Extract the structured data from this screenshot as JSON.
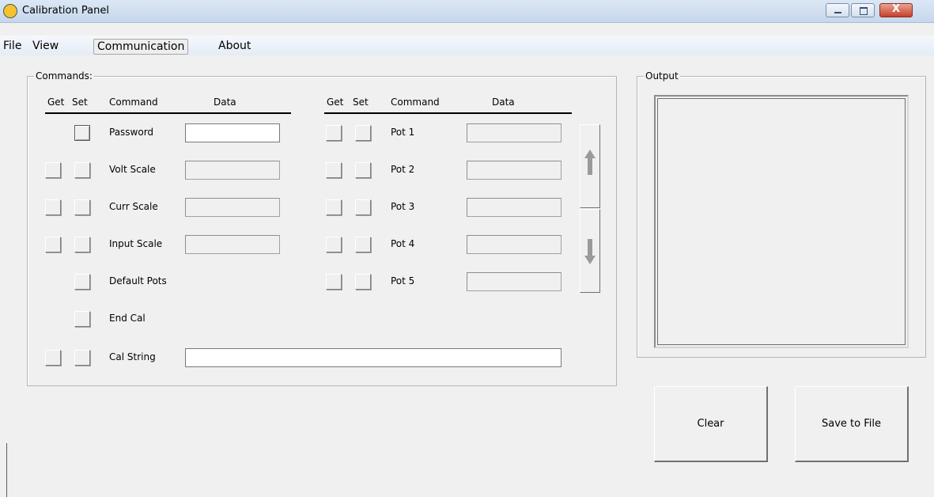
{
  "window": {
    "title": "Calibration Panel",
    "icon": "calibration-app-icon",
    "controls": {
      "minimize": "minimize-icon",
      "maximize": "maximize-icon",
      "close_glyph": "X"
    }
  },
  "menu": {
    "items": [
      "File",
      "View",
      "Communication",
      "About"
    ],
    "active": "Communication"
  },
  "commands": {
    "legend": "Commands:",
    "left_headers": {
      "get": "Get",
      "set": "Set",
      "command": "Command",
      "data": "Data"
    },
    "right_headers": {
      "get": "Get",
      "set": "Set",
      "command": "Command",
      "data": "Data"
    },
    "left_rows": [
      {
        "label": "Password",
        "has_get": false,
        "has_data": true,
        "data_value": ""
      },
      {
        "label": "Volt Scale",
        "has_get": true,
        "has_data": true,
        "data_value": ""
      },
      {
        "label": "Curr Scale",
        "has_get": true,
        "has_data": true,
        "data_value": ""
      },
      {
        "label": "Input Scale",
        "has_get": true,
        "has_data": true,
        "data_value": ""
      },
      {
        "label": "Default Pots",
        "has_get": false,
        "has_data": false
      },
      {
        "label": "End Cal",
        "has_get": false,
        "has_data": false
      },
      {
        "label": "Cal String",
        "has_get": true,
        "has_data": true,
        "data_value": ""
      }
    ],
    "right_rows": [
      {
        "label": "Pot 1",
        "data_value": ""
      },
      {
        "label": "Pot 2",
        "data_value": ""
      },
      {
        "label": "Pot 3",
        "data_value": ""
      },
      {
        "label": "Pot 4",
        "data_value": ""
      },
      {
        "label": "Pot 5",
        "data_value": ""
      }
    ],
    "scroll_up_icon": "arrow-up-icon",
    "scroll_down_icon": "arrow-down-icon"
  },
  "output": {
    "legend": "Output",
    "content": ""
  },
  "buttons": {
    "clear": "Clear",
    "save": "Save to File"
  }
}
